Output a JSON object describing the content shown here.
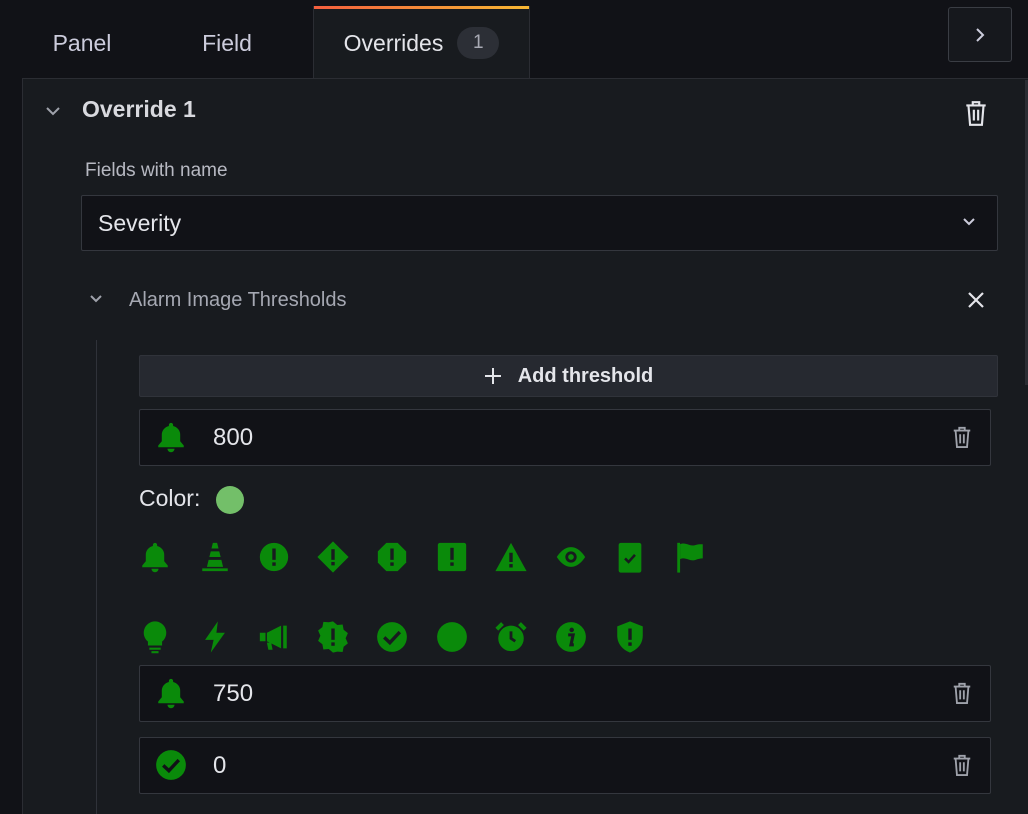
{
  "tabs": [
    {
      "label": "Panel"
    },
    {
      "label": "Field"
    },
    {
      "label": "Overrides",
      "count": "1"
    }
  ],
  "override": {
    "title": "Override 1",
    "matcher_label": "Fields with name",
    "matcher_value": "Severity",
    "property_title": "Alarm Image Thresholds",
    "add_threshold_label": "Add threshold",
    "color_label": "Color:",
    "selected_color": "#73bf69",
    "icon_color": "#0a8a0a",
    "thresholds": [
      {
        "icon": "bell-icon",
        "value": "800"
      },
      {
        "icon": "bell-icon",
        "value": "750"
      },
      {
        "icon": "check-circle-icon",
        "value": "0"
      }
    ],
    "icon_picker_row1": [
      "bell-icon",
      "traffic-cone-icon",
      "exclamation-circle-icon",
      "exclamation-diamond-icon",
      "exclamation-octagon-icon",
      "exclamation-square-icon",
      "warning-triangle-icon",
      "eye-icon",
      "clipboard-check-icon",
      "flag-icon"
    ],
    "icon_picker_row2": [
      "lightbulb-icon",
      "bolt-icon",
      "megaphone-icon",
      "exclamation-badge-icon",
      "check-circle-icon",
      "circle-icon",
      "alarm-clock-icon",
      "info-circle-icon",
      "shield-exclamation-icon"
    ]
  }
}
